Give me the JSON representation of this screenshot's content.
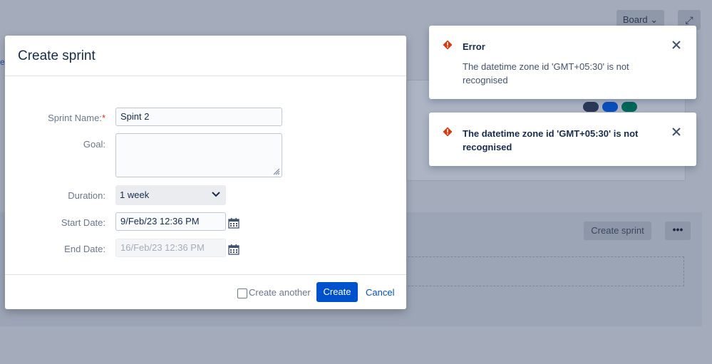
{
  "background": {
    "board_label": "Board",
    "create_sprint_label": "Create sprint",
    "more_label": "•••",
    "side_text": "e",
    "status_dots": [
      "#2b3a57",
      "#0b4fbe",
      "#00695a"
    ]
  },
  "modal": {
    "title": "Create sprint",
    "fields": {
      "sprint_name_label": "Sprint Name:",
      "required_mark": "*",
      "sprint_name_value": "Spint 2",
      "goal_label": "Goal:",
      "goal_value": "",
      "duration_label": "Duration:",
      "duration_value": "1 week",
      "start_date_label": "Start Date:",
      "start_date_value": "9/Feb/23 12:36 PM",
      "end_date_label": "End Date:",
      "end_date_value": "16/Feb/23 12:36 PM"
    },
    "footer": {
      "create_another_label": "Create another",
      "create_label": "Create",
      "cancel_label": "Cancel"
    }
  },
  "flags": [
    {
      "title": "Error",
      "body": "The datetime zone id 'GMT+05:30' is not recognised"
    },
    {
      "title": "The datetime zone id 'GMT+05:30' is not recognised",
      "body": ""
    }
  ],
  "colors": {
    "primary": "#0052cc",
    "error_icon": "#de350b",
    "overlay": "#a4acbc"
  }
}
